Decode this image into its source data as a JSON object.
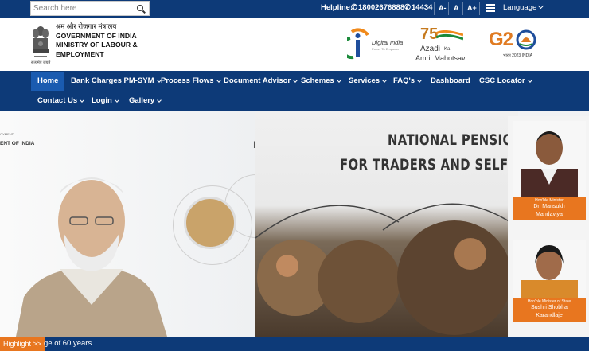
{
  "topbar": {
    "search_placeholder": "Search here",
    "helpline_label": "Helpline:",
    "helpline_number": "18002676888",
    "helpline_short": "14434",
    "font_decrease": "A-",
    "font_normal": "A",
    "font_increase": "A+",
    "language_label": "Language"
  },
  "header": {
    "org_hindi": "श्रम और रोजगार मंत्रालय",
    "org_line1": "GOVERNMENT OF INDIA",
    "org_line2": "MINISTRY OF LABOUR &",
    "org_line3": "EMPLOYMENT",
    "emblem_motto": "सत्यमेव जयते",
    "digital_india": "Digital India",
    "digital_india_sub": "Power To Empower",
    "azadi_75": "75",
    "azadi_word": "Azadi",
    "azadi_ka": "Ka",
    "azadi_line2": "Amrit Mahotsav",
    "g20_bharat": "भारत 2023 INDIA"
  },
  "nav": {
    "items": [
      {
        "label": "Home",
        "has_dropdown": false
      },
      {
        "label": "Bank Charges PM-SYM",
        "has_dropdown": true
      },
      {
        "label": "Process Flows",
        "has_dropdown": true
      },
      {
        "label": "Document Advisor",
        "has_dropdown": true
      },
      {
        "label": "Schemes",
        "has_dropdown": true
      },
      {
        "label": "Services",
        "has_dropdown": true
      },
      {
        "label": "FAQ's",
        "has_dropdown": true
      },
      {
        "label": "Dashboard",
        "has_dropdown": false
      },
      {
        "label": "CSC Locator",
        "has_dropdown": true
      },
      {
        "label": "Contact Us",
        "has_dropdown": true
      },
      {
        "label": "Login",
        "has_dropdown": true
      },
      {
        "label": "Gallery",
        "has_dropdown": true
      }
    ]
  },
  "hero": {
    "left_small": "ENT OF INDIA",
    "left_tiny": "OYMENT",
    "title_line1": "NATIONAL PENSION S",
    "title_line2": "FOR TRADERS AND SELF EMPL",
    "letter_p": "P"
  },
  "ministers": [
    {
      "role": "Hon'ble Minister",
      "name_line1": "Dr. Mansukh",
      "name_line2": "Mandaviya"
    },
    {
      "role": "Hon'ble Minister of State",
      "name_line1": "Sushri Shobha",
      "name_line2": "Karandlaje"
    }
  ],
  "ticker": {
    "highlight_label": "Highlight >>",
    "text": "ge of 60 years."
  },
  "colors": {
    "navy": "#0d3a78",
    "active_nav": "#1a5bb0",
    "orange": "#e8761f"
  }
}
